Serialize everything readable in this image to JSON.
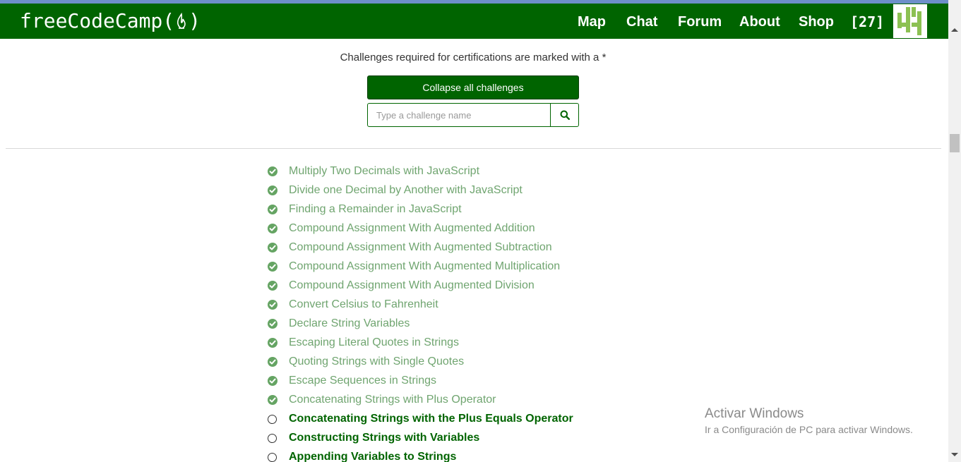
{
  "navbar": {
    "brand": "freeCodeCamp(",
    "brand_close": ")",
    "links": [
      {
        "label": "Map"
      },
      {
        "label": "Chat"
      },
      {
        "label": "Forum"
      },
      {
        "label": "About"
      },
      {
        "label": "Shop"
      }
    ],
    "points": "[27]",
    "accent_color": "#006400"
  },
  "notice": "Challenges required for certifications are marked with a *",
  "collapse_button": "Collapse all challenges",
  "search": {
    "placeholder": "Type a challenge name",
    "value": "",
    "icon": "search-icon"
  },
  "challenges": [
    {
      "title": "Multiply Two Decimals with JavaScript",
      "completed": true
    },
    {
      "title": "Divide one Decimal by Another with JavaScript",
      "completed": true
    },
    {
      "title": "Finding a Remainder in JavaScript",
      "completed": true
    },
    {
      "title": "Compound Assignment With Augmented Addition",
      "completed": true
    },
    {
      "title": "Compound Assignment With Augmented Subtraction",
      "completed": true
    },
    {
      "title": "Compound Assignment With Augmented Multiplication",
      "completed": true
    },
    {
      "title": "Compound Assignment With Augmented Division",
      "completed": true
    },
    {
      "title": "Convert Celsius to Fahrenheit",
      "completed": true
    },
    {
      "title": "Declare String Variables",
      "completed": true
    },
    {
      "title": "Escaping Literal Quotes in Strings",
      "completed": true
    },
    {
      "title": "Quoting Strings with Single Quotes",
      "completed": true
    },
    {
      "title": "Escape Sequences in Strings",
      "completed": true
    },
    {
      "title": "Concatenating Strings with Plus Operator",
      "completed": true
    },
    {
      "title": "Concatenating Strings with the Plus Equals Operator",
      "completed": false
    },
    {
      "title": "Constructing Strings with Variables",
      "completed": false
    },
    {
      "title": "Appending Variables to Strings",
      "completed": false
    }
  ],
  "watermark": {
    "title": "Activar Windows",
    "subtitle": "Ir a Configuración de PC para activar Windows."
  }
}
